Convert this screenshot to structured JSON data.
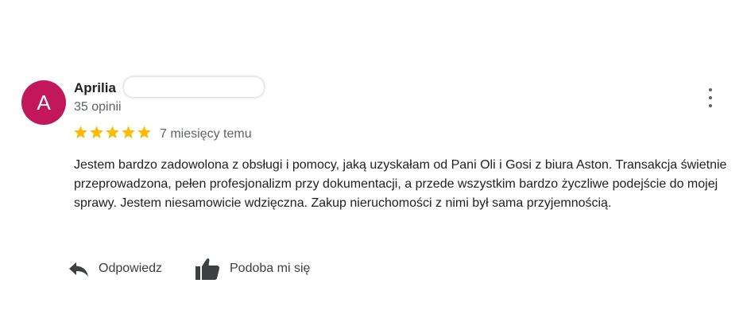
{
  "review": {
    "avatar_letter": "A",
    "avatar_color": "#c2185b",
    "author_name": "Aprilia",
    "review_count": "35 opinii",
    "rating": 5,
    "rating_max": 5,
    "star_color": "#fbbc04",
    "time_ago": "7 miesięcy temu",
    "text": "Jestem bardzo zadowolona z obsługi i pomocy, jaką uzyskałam od Pani Oli i Gosi z biura Aston. Transakcja świetnie przeprowadzona, pełen profesjonalizm przy dokumentacji, a przede wszystkim bardzo życzliwe podejście do mojej sprawy. Jestem niesamowicie wdzięczna. Zakup nieruchomości z nimi był sama przyjemnością."
  },
  "actions": {
    "reply_label": "Odpowiedz",
    "reply_icon": "reply-icon",
    "like_label": "Podoba mi się",
    "like_icon": "thumbs-up-icon"
  },
  "menu_icon": "more-vert-icon"
}
